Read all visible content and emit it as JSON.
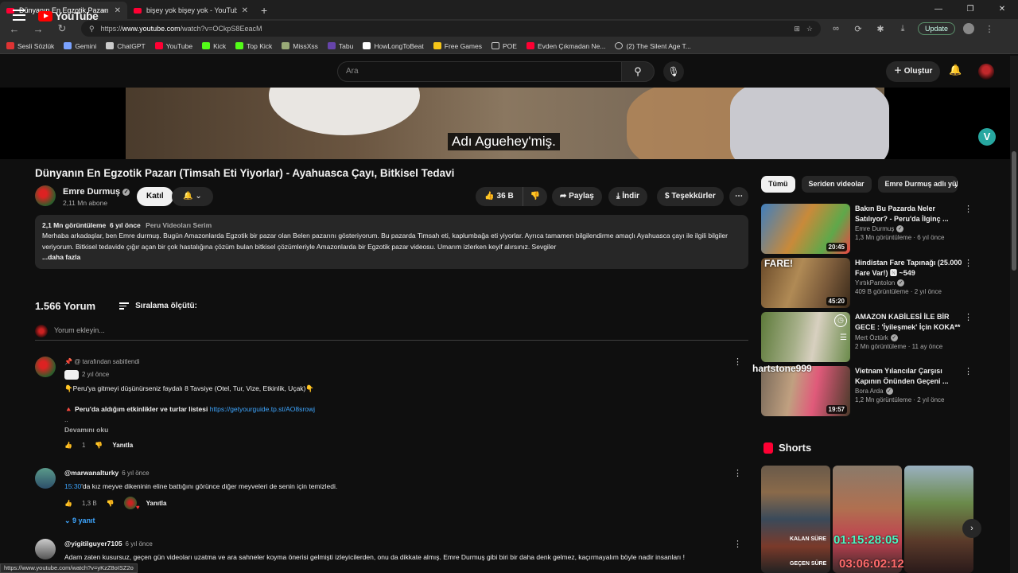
{
  "browser": {
    "tabs": [
      {
        "title": "Dünyanın En Egzotik Pazarı (Timsa",
        "active": true
      },
      {
        "title": "bişey yok bişey yok - YouTube",
        "active": false
      }
    ],
    "url_prefix": "https://",
    "url_domain": "www.youtube.com",
    "url_path": "/watch?v=OCkpS8EeacM",
    "update_label": "Update",
    "bookmarks": [
      "Sesli Sözlük",
      "Gemini",
      "ChatGPT",
      "YouTube",
      "Kick",
      "Top Kick",
      "MissXss",
      "Tabu",
      "HowLongToBeat",
      "Free Games",
      "POE",
      "Evden Çıkmadan Ne...",
      "(2) The Silent Age T..."
    ],
    "status_url": "https://www.youtube.com/watch?v=yKzZ8oISZ2o"
  },
  "header": {
    "logo_text": "YouTube",
    "logo_region": "TR",
    "search_placeholder": "Ara",
    "create_label": "Oluştur"
  },
  "player": {
    "subtitle": "Adı Aguehey'miş."
  },
  "video": {
    "title": "Dünyanın En Egzotik Pazarı (Timsah Eti Yiyorlar) - Ayahuasca Çayı, Bitkisel Tedavi",
    "channel": "Emre Durmuş",
    "subscribers": "2,11 Mn abone",
    "join_label": "Katıl",
    "likes": "36 B",
    "share_label": "Paylaş",
    "download_label": "İndir",
    "thanks_label": "Teşekkürler",
    "description": {
      "views": "2,1 Mn görüntüleme",
      "age": "6 yıl önce",
      "tag": "Peru Videoları Serim",
      "text": "Merhaba arkadaşlar, ben Emre durmuş. Bugün Amazonlarda Egzotik bir pazar olan Belen pazarını gösteriyorum. Bu pazarda Timsah eti, kaplumbağa eti yiyorlar. Ayrıca tamamen bilgilendirme amaçlı Ayahuasca çayı ile ilgili bilgiler veriyorum. Bitkisel tedavide çığır açan bir çok hastalığına çözüm bulan bitkisel çözümleriyle Amazonlarda bir Egzotik pazar videosu. Umarım izlerken keyif alırsınız. Sevgiler",
      "more": "...daha fazla"
    }
  },
  "comments": {
    "count_label": "1.566 Yorum",
    "sort_label": "Sıralama ölçütü:",
    "add_placeholder": "Yorum ekleyin...",
    "items": [
      {
        "pinned": "@ tarafından sabitlendi",
        "age": "2 yıl önce",
        "line1": "👇Peru'ya gitmeyi düşünürseniz faydalı 8 Tavsiye (Otel, Tur, Vize, Etkinlik, Uçak)👇",
        "line2_prefix": "🔺 Peru'da aldığım etkinlikler ve turlar listesi",
        "line2_link": "https://getyourguide.tp.st/AO8srowj",
        "dots": "..",
        "more": "Devamını oku",
        "likes": "1",
        "reply": "Yanıtla"
      },
      {
        "author": "@marwanalturky",
        "age": "6 yıl önce",
        "timestamp": "15:30",
        "text": "'da kız meyve dikeninin eline battığını görünce diğer meyveleri de senin için temizledi.",
        "likes": "1,3 B",
        "reply": "Yanıtla",
        "replies": "9 yanıt"
      },
      {
        "author": "@yigitilguyer7105",
        "age": "6 yıl önce",
        "text": "Adam zaten kusursuz, geçen gün videoları uzatma ve ara sahneler koyma önerisi gelmişti izleyicilerden, onu da dikkate almış. Emre Durmuş gibi biri bir daha denk gelmez, kaçırmayalım böyle nadir insanları !"
      }
    ]
  },
  "sidebar": {
    "chips": [
      "Tümü",
      "Seriden videolar",
      "Emre Durmuş adlı yük"
    ],
    "recommended": [
      {
        "title": "Bakın Bu Pazarda Neler Satılıyor? - Peru'da İlginç ...",
        "channel": "Emre Durmuş",
        "meta": "1,3 Mn görüntüleme · 6 yıl önce",
        "duration": "20:45"
      },
      {
        "title": "Hindistan Fare Tapınağı (25.000 Fare Var!) 🅽 ~549",
        "channel": "YırtıkPantolon",
        "meta": "409 B görüntüleme · 2 yıl önce",
        "duration": "45:20",
        "thumb_text": "FARE!"
      },
      {
        "title": "AMAZON KABİLESİ İLE BİR GECE : 'İyileşmek' İçin KOKA** ...",
        "channel": "Mert Öztürk",
        "meta": "2 Mn görüntüleme · 11 ay önce",
        "duration": ""
      },
      {
        "title": "Vietnam Yılancılar Çarşısı Kapının Önünden Geçeni ...",
        "channel": "Bora Arda",
        "meta": "1,2 Mn görüntüleme · 2 yıl önce",
        "duration": "19:57"
      }
    ],
    "overlay_name": "hartstone999",
    "shorts_title": "Shorts",
    "shorts": {
      "timer_a": "01:15:28:05",
      "timer_b": "03:06:02:12",
      "label_a": "KALAN SÜRE",
      "label_b": "GEÇEN SÜRE"
    }
  },
  "colors": {
    "accent_red": "#ff0033",
    "link_blue": "#3ea6ff",
    "bg": "#0f0f0f"
  }
}
